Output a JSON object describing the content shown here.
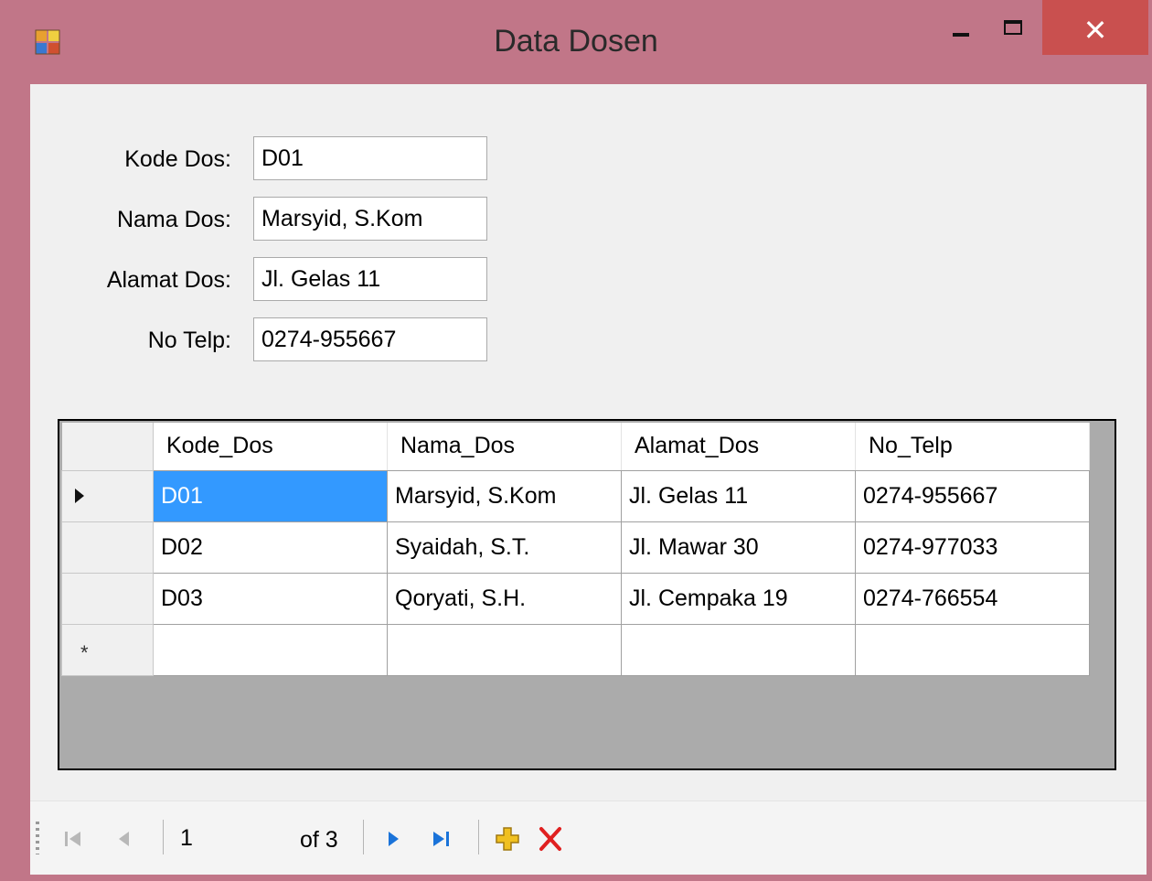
{
  "window": {
    "title": "Data Dosen"
  },
  "form": {
    "fields": [
      {
        "label": "Kode Dos:",
        "value": "D01"
      },
      {
        "label": "Nama Dos:",
        "value": "Marsyid, S.Kom"
      },
      {
        "label": "Alamat Dos:",
        "value": "Jl. Gelas 11"
      },
      {
        "label": "No Telp:",
        "value": "0274-955667"
      }
    ]
  },
  "grid": {
    "columns": [
      "Kode_Dos",
      "Nama_Dos",
      "Alamat_Dos",
      "No_Telp"
    ],
    "rows": [
      [
        "D01",
        "Marsyid, S.Kom",
        "Jl. Gelas 11",
        "0274-955667"
      ],
      [
        "D02",
        "Syaidah, S.T.",
        "Jl. Mawar 30",
        "0274-977033"
      ],
      [
        "D03",
        "Qoryati, S.H.",
        "Jl. Cempaka 19",
        "0274-766554"
      ]
    ],
    "selected_row": 0,
    "new_row_marker": "*"
  },
  "navigator": {
    "position": "1",
    "count_label": "of 3",
    "icons": [
      "move-first-icon",
      "move-previous-icon",
      "move-next-icon",
      "move-last-icon",
      "add-new-icon",
      "delete-icon"
    ]
  },
  "colors": {
    "window_frame": "#c17688",
    "close_button": "#c9504f",
    "selection": "#3399ff",
    "nav_blue": "#1a73d9",
    "delete_red": "#e02020",
    "add_yellow": "#f0c020"
  }
}
